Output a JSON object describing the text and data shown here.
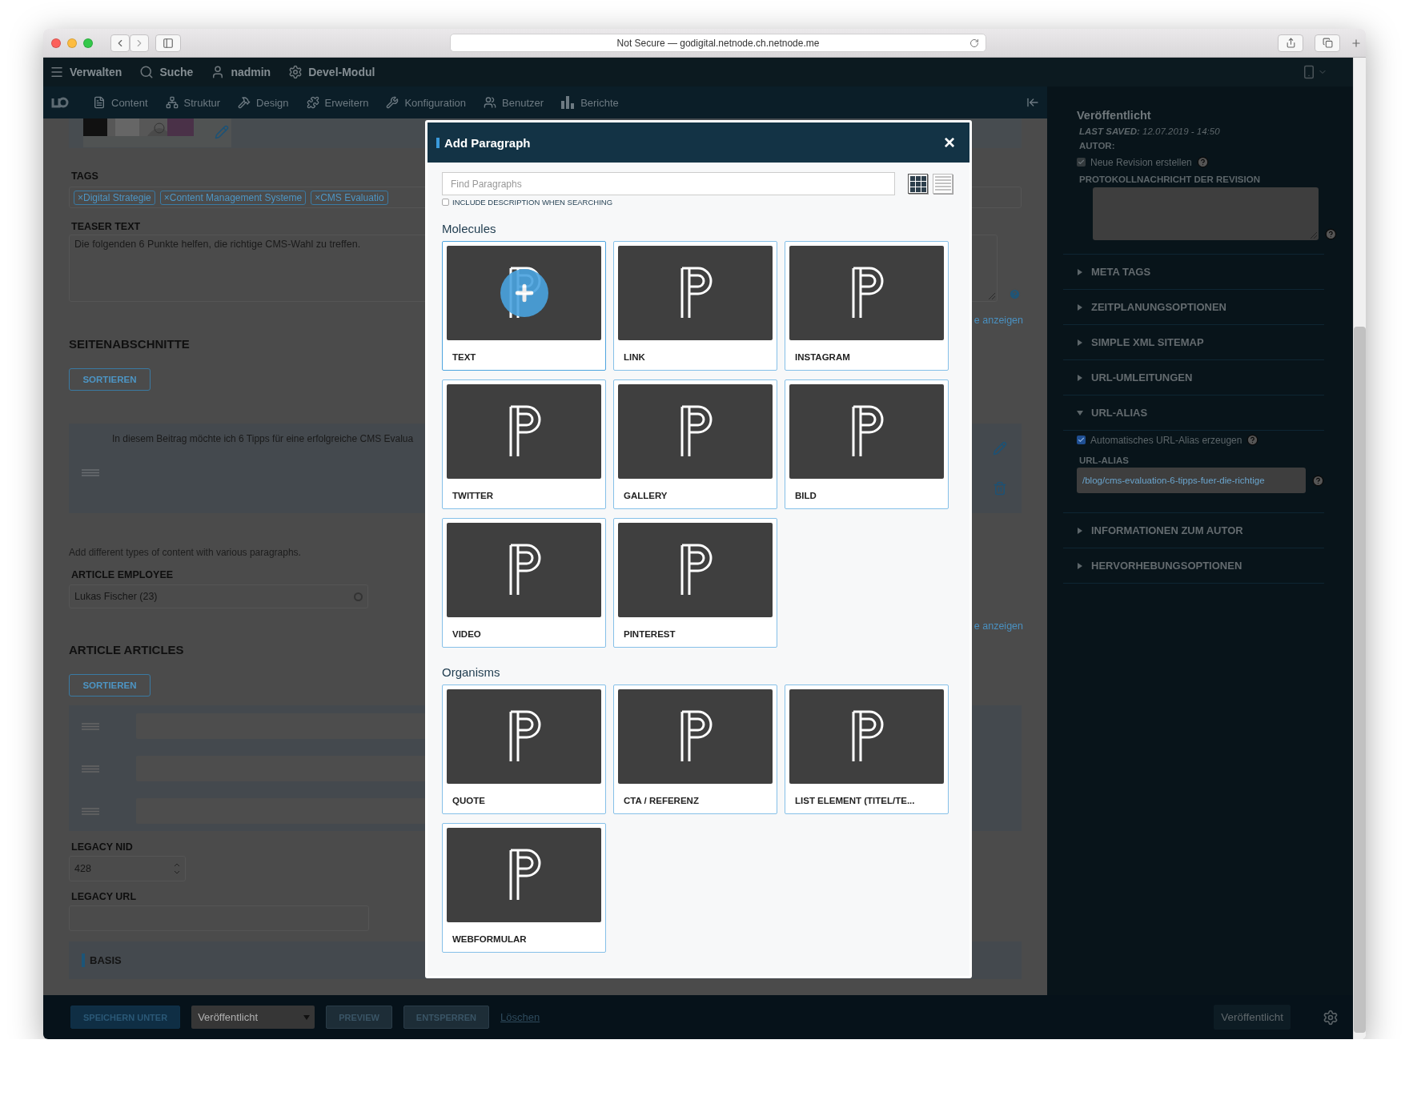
{
  "browser": {
    "address": "Not Secure — godigital.netnode.ch.netnode.me"
  },
  "admin_toolbar": {
    "items": [
      {
        "label": "Verwalten"
      },
      {
        "label": "Suche"
      },
      {
        "label": "nadmin"
      },
      {
        "label": "Devel-Modul"
      }
    ]
  },
  "main_menu": {
    "items": [
      {
        "label": "Content"
      },
      {
        "label": "Struktur"
      },
      {
        "label": "Design"
      },
      {
        "label": "Erweitern"
      },
      {
        "label": "Konfiguration"
      },
      {
        "label": "Benutzer"
      },
      {
        "label": "Berichte"
      }
    ]
  },
  "content": {
    "tags_label": "TAGS",
    "tags": [
      {
        "remove": "×",
        "label": "Digital Strategie"
      },
      {
        "remove": "×",
        "label": "Content Management Systeme"
      },
      {
        "remove": "×",
        "label": "CMS Evaluatio"
      }
    ],
    "teaser_label": "TEASER TEXT",
    "teaser_text": "Die folgenden 6 Punkte helfen, die richtige CMS-Wahl zu treffen.",
    "show_link_1": "e anzeigen",
    "sections_heading": "SEITENABSCHNITTE",
    "sort_button_1": "SORTIEREN",
    "paragraph_text": "In diesem Beitrag möchte ich 6 Tipps für eine erfolgreiche CMS Evalua",
    "help_text": "Add different types of content with various paragraphs.",
    "employee_label": "ARTICLE EMPLOYEE",
    "employee_value": "Lukas Fischer (23)",
    "show_link_2": "e anzeigen",
    "articles_heading": "ARTICLE ARTICLES",
    "sort_button_2": "SORTIEREN",
    "legacy_nid_label": "LEGACY NID",
    "legacy_nid_value": "428",
    "legacy_url_label": "LEGACY URL",
    "basis_label": "BASIS"
  },
  "sidebar": {
    "status": "Veröffentlicht",
    "last_saved_label": "LAST SAVED:",
    "last_saved_value": "12.07.2019 - 14:50",
    "author_label": "AUTOR:",
    "new_revision": {
      "label": "Neue Revision erstellen",
      "checked": true,
      "disabled": true
    },
    "revision_log_label": "PROTOKOLLNACHRICHT DER REVISION",
    "sections": [
      {
        "label": "META TAGS",
        "expanded": false
      },
      {
        "label": "ZEITPLANUNGSOPTIONEN",
        "expanded": false
      },
      {
        "label": "SIMPLE XML SITEMAP",
        "expanded": false
      },
      {
        "label": "URL-UMLEITUNGEN",
        "expanded": false
      },
      {
        "label": "URL-ALIAS",
        "expanded": true,
        "checkbox": {
          "label": "Automatisches URL-Alias erzeugen",
          "checked": true,
          "disabled": false
        },
        "field_label": "URL-ALIAS",
        "field_value": "/blog/cms-evaluation-6-tipps-fuer-die-richtige"
      },
      {
        "label": "INFORMATIONEN ZUM AUTOR",
        "expanded": false
      },
      {
        "label": "HERVORHEBUNGSOPTIONEN",
        "expanded": false
      }
    ]
  },
  "bottom_bar": {
    "save_button": "SPEICHERN UNTER",
    "status_select": "Veröffentlicht",
    "preview_button": "PREVIEW",
    "unlock_button": "ENTSPERREN",
    "delete_link": "Löschen",
    "status_button": "Veröffentlicht"
  },
  "modal": {
    "title": "Add Paragraph",
    "close": "×",
    "search_placeholder": "Find Paragraphs",
    "include_description": {
      "label": "INCLUDE DESCRIPTION WHEN SEARCHING",
      "checked": false
    },
    "view_modes": [
      {
        "kind": "grid",
        "selected": true
      },
      {
        "kind": "list",
        "selected": false
      }
    ],
    "groups": [
      {
        "title": "Molecules",
        "items": [
          {
            "label": "TEXT",
            "hovered": true
          },
          {
            "label": "LINK",
            "hovered": false
          },
          {
            "label": "INSTAGRAM",
            "hovered": false
          },
          {
            "label": "TWITTER",
            "hovered": false
          },
          {
            "label": "GALLERY",
            "hovered": false
          },
          {
            "label": "BILD",
            "hovered": false
          },
          {
            "label": "VIDEO",
            "hovered": false
          },
          {
            "label": "PINTEREST",
            "hovered": false
          }
        ]
      },
      {
        "title": "Organisms",
        "items": [
          {
            "label": "QUOTE",
            "hovered": false
          },
          {
            "label": "CTA / REFERENZ",
            "hovered": false
          },
          {
            "label": "LIST ELEMENT (TITEL/TE...",
            "hovered": false
          },
          {
            "label": "WEBFORMULAR",
            "hovered": false
          }
        ]
      }
    ]
  }
}
